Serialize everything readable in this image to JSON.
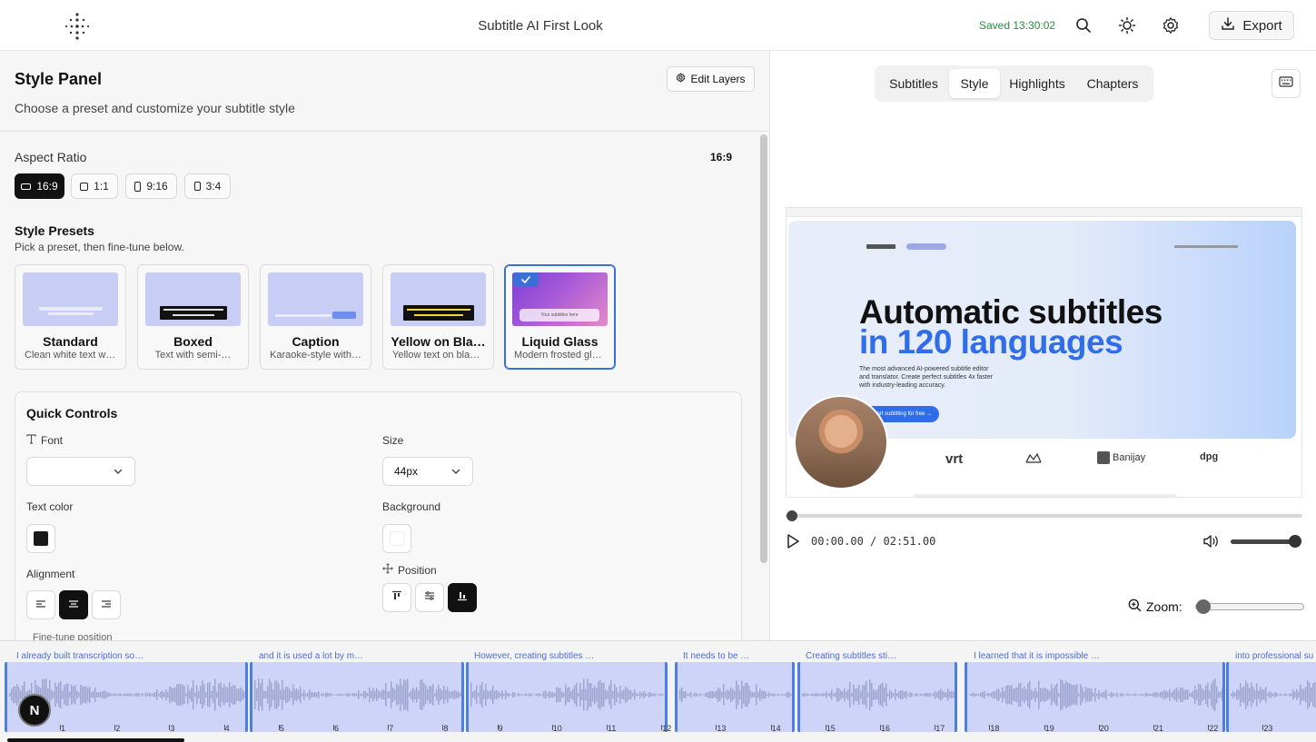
{
  "header": {
    "doc_title": "Subtitle AI First Look",
    "saved_status": "Saved 13:30:02",
    "export_label": "Export",
    "icons": [
      "sparkle-logo-icon",
      "search-icon",
      "sun-icon",
      "gear-icon",
      "download-icon"
    ]
  },
  "style_panel": {
    "title": "Style Panel",
    "subtitle": "Choose a preset and customize your subtitle style",
    "edit_layers_label": "Edit Layers",
    "aspect_ratio": {
      "label": "Aspect Ratio",
      "value": "16:9",
      "options": [
        "16:9",
        "1:1",
        "9:16",
        "3:4"
      ],
      "selected": "16:9"
    },
    "presets": {
      "label": "Style Presets",
      "sub": "Pick a preset, then fine-tune below.",
      "items": [
        {
          "name": "Standard",
          "desc": "Clean white text wi…"
        },
        {
          "name": "Boxed",
          "desc": "Text with semi-…"
        },
        {
          "name": "Caption",
          "desc": "Karaoke-style with…"
        },
        {
          "name": "Yellow on Bla…",
          "desc": "Yellow text on blac…"
        },
        {
          "name": "Liquid Glass",
          "desc": "Modern frosted gla…",
          "thumb_text": "Your subtitles here"
        }
      ],
      "selected": "Liquid Glass"
    },
    "quick_controls": {
      "title": "Quick Controls",
      "font_label": "Font",
      "font_value": "",
      "size_label": "Size",
      "size_value": "44px",
      "text_color_label": "Text color",
      "text_color": "#1a1a1a",
      "background_label": "Background",
      "background_color": "#ffffff",
      "alignment_label": "Alignment",
      "alignment_selected": "center",
      "position_label": "Position",
      "position_selected": "bottom",
      "peek_label": "Fine-tune position"
    }
  },
  "preview": {
    "tabs": [
      "Subtitles",
      "Style",
      "Highlights",
      "Chapters"
    ],
    "active_tab": "Style",
    "video": {
      "headline_1": "Automatic subtitles",
      "headline_2": "in 120 languages",
      "paragraph": "The most advanced AI-powered subtitle editor and translator. Create perfect subtitles 4x faster with industry-leading accuracy.",
      "cta": "Start subtitling for free →",
      "brand_logos": [
        "vrt",
        "Banijay",
        "dpg"
      ]
    },
    "time_current": "00:00.00",
    "time_separator": "/",
    "time_total": "02:51.00",
    "progress": 0.0,
    "volume": 1.0,
    "zoom_label": "Zoom:",
    "zoom_level": 0.05
  },
  "timeline": {
    "segments": [
      {
        "label": "I already built transcription so…"
      },
      {
        "label": "and it is used a lot by m…"
      },
      {
        "label": "However, creating subtitles …"
      },
      {
        "label": "It needs to be …"
      },
      {
        "label": "Creating subtitles sti…"
      },
      {
        "label": "I learned that it is impossible …"
      },
      {
        "label": "into professional su"
      }
    ],
    "ticks": [
      "1",
      "2",
      "3",
      "4",
      "5",
      "6",
      "7",
      "8",
      "9",
      "10",
      "11",
      "12",
      "13",
      "14",
      "15",
      "16",
      "17",
      "18",
      "19",
      "20",
      "21",
      "22",
      "23"
    ],
    "avatar_letter": "N"
  },
  "colors": {
    "accent": "#2f6ee8",
    "saved_green": "#2e8b3e",
    "segment_fill": "#cdd4f7",
    "segment_border": "#4c7fe0"
  }
}
